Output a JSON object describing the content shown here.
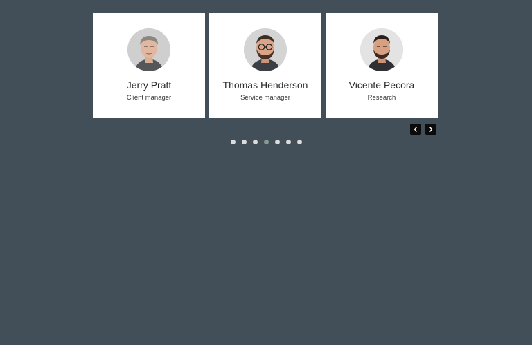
{
  "carousel": {
    "cards": [
      {
        "name": "Jerry Pratt",
        "role": "Client manager"
      },
      {
        "name": "Thomas Henderson",
        "role": "Service manager"
      },
      {
        "name": "Vicente Pecora",
        "role": "Research"
      }
    ],
    "pagination": {
      "total": 7,
      "active_index": 3
    },
    "controls": {
      "prev_icon": "chevron-left-icon",
      "next_icon": "chevron-right-icon"
    }
  },
  "colors": {
    "background": "#424f58",
    "card": "#ffffff",
    "dot": "#dcdcdc",
    "dot_active": "#8a9a92",
    "button": "#0b0b0b"
  }
}
